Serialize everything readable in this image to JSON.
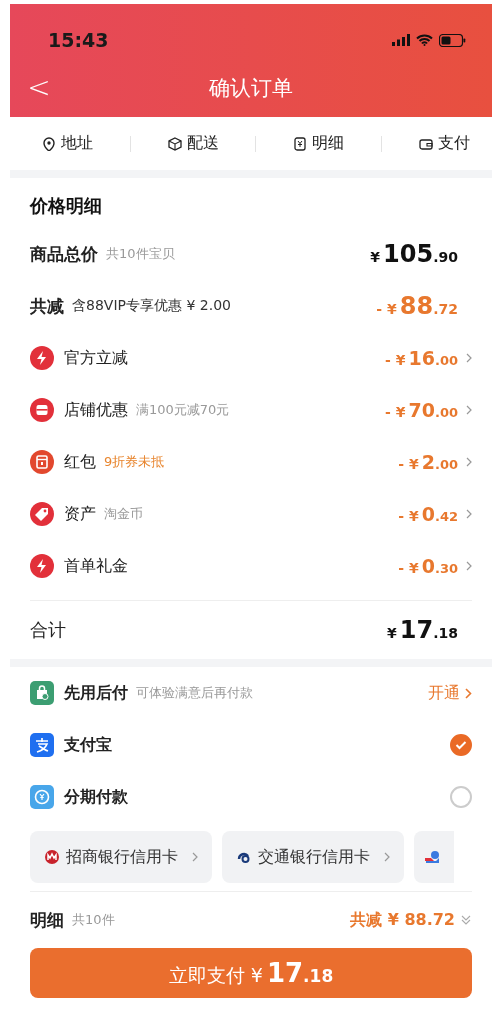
{
  "status_bar": {
    "time": "15:43"
  },
  "nav": {
    "back": "<",
    "title": "确认订单"
  },
  "anchors": [
    {
      "label": "地址"
    },
    {
      "label": "配送"
    },
    {
      "label": "明细"
    },
    {
      "label": "支付"
    }
  ],
  "price_detail": {
    "title": "价格明细",
    "rows": [
      {
        "kind": "total",
        "label": "商品总价",
        "note": "共10件宝贝",
        "price": {
          "currency": "¥",
          "integer": "105",
          "decimal": ".90"
        }
      },
      {
        "kind": "reduction",
        "label": "共减",
        "note": "含88VIP专享优惠 ¥ 2.00",
        "price": {
          "currency": "- ¥",
          "integer": "88",
          "decimal": ".72"
        }
      },
      {
        "kind": "discount",
        "label": "官方立减",
        "price": {
          "currency": "- ¥",
          "integer": "16",
          "decimal": ".00"
        }
      },
      {
        "kind": "discount",
        "label": "店铺优惠",
        "note": "满100元减70元",
        "note_highlighted": false,
        "price": {
          "currency": "- ¥",
          "integer": "70",
          "decimal": ".00"
        }
      },
      {
        "kind": "discount",
        "label": "红包",
        "note": "9折券未抵",
        "note_highlighted": true,
        "price": {
          "currency": "- ¥",
          "integer": "2",
          "decimal": ".00"
        }
      },
      {
        "kind": "discount",
        "label": "资产",
        "note": "淘金币",
        "note_highlighted": false,
        "price": {
          "currency": "- ¥",
          "integer": "0",
          "decimal": ".42"
        }
      },
      {
        "kind": "discount",
        "label": "首单礼金",
        "price": {
          "currency": "- ¥",
          "integer": "0",
          "decimal": ".30"
        }
      }
    ],
    "sum": {
      "label": "合计",
      "price": {
        "currency": "¥",
        "integer": "17",
        "decimal": ".18"
      }
    }
  },
  "payment": {
    "methods": [
      {
        "kind": "later",
        "label": "先用后付",
        "note": "可体验满意后再付款",
        "action": "开通"
      },
      {
        "kind": "option",
        "label": "支付宝",
        "selected": true
      },
      {
        "kind": "option",
        "label": "分期付款",
        "selected": false
      }
    ],
    "cards": [
      {
        "label": "招商银行信用卡"
      },
      {
        "label": "交通银行信用卡"
      },
      {
        "kind": "partial"
      }
    ]
  },
  "footer": {
    "label": "明细",
    "count": "共10件",
    "saving": "共减 ¥ 88.72",
    "pay_button": {
      "label": "立即支付 ¥",
      "integer": "17",
      "decimal": ".18"
    }
  }
}
